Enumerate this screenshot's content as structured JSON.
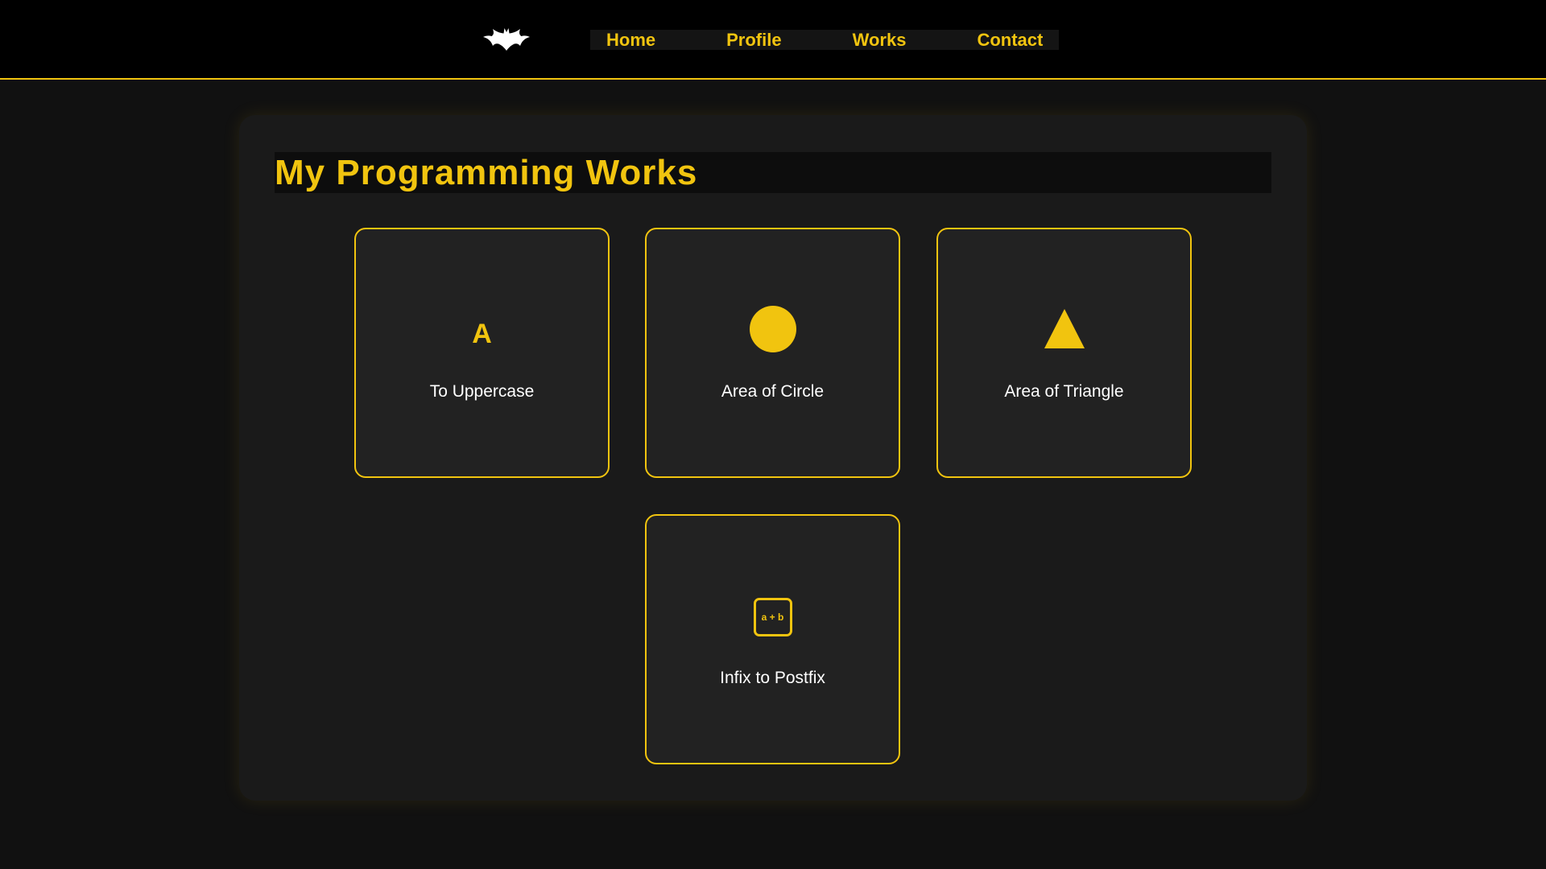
{
  "header": {
    "logo_icon": "bat-icon",
    "nav": [
      {
        "label": "Home"
      },
      {
        "label": "Profile"
      },
      {
        "label": "Works"
      },
      {
        "label": "Contact"
      }
    ]
  },
  "main": {
    "title": "My Programming Works",
    "cards": [
      {
        "icon": "letter-a-icon",
        "icon_text": "A",
        "label": "To Uppercase"
      },
      {
        "icon": "circle-icon",
        "label": "Area of Circle"
      },
      {
        "icon": "triangle-icon",
        "label": "Area of Triangle"
      },
      {
        "icon": "expression-icon",
        "icon_text": "a + b",
        "label": "Infix to Postfix"
      }
    ]
  },
  "colors": {
    "accent": "#f1c40f",
    "background": "#111111",
    "panel": "#1a1a1a",
    "card": "#222222",
    "topbar": "#000000"
  }
}
